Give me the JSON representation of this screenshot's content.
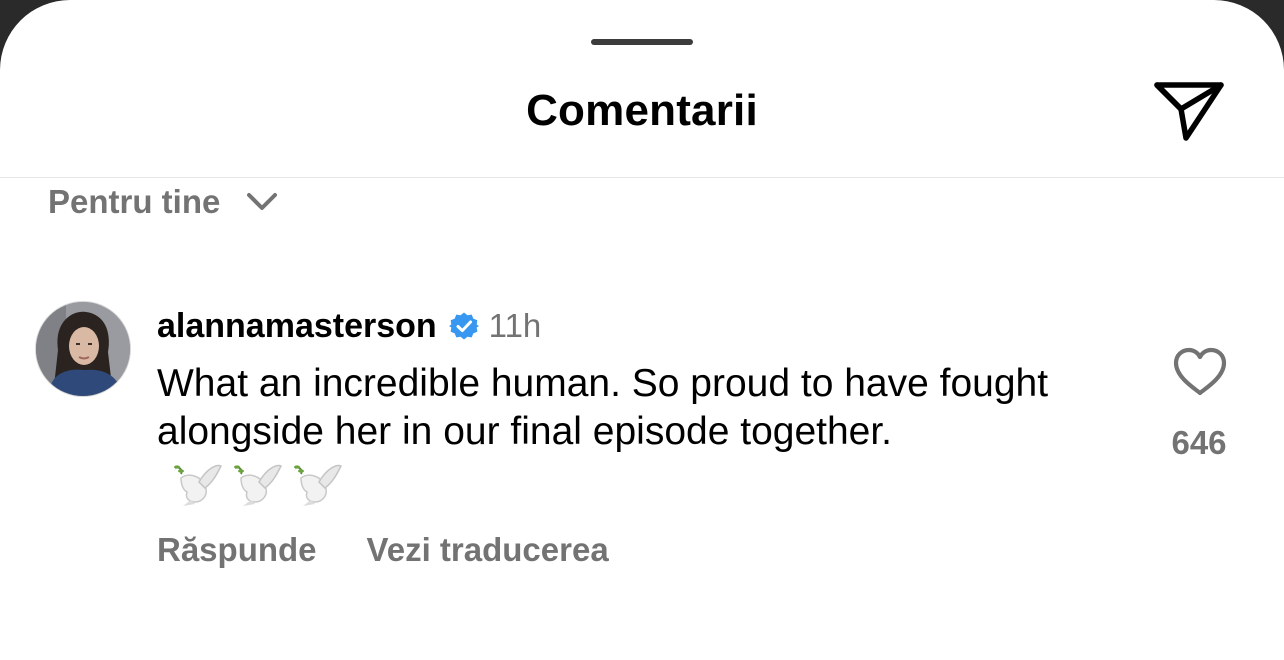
{
  "sheet": {
    "title": "Comentarii",
    "share_icon": "paper-plane-icon"
  },
  "sort": {
    "label": "Pentru tine",
    "icon": "chevron-down-icon"
  },
  "comment": {
    "username": "alannamasterson",
    "verified": true,
    "verified_color": "#3897f0",
    "timestamp": "11h",
    "text": "What an incredible human. So proud to have fought alongside her in our final episode together.",
    "emoji": "🕊️🕊️🕊️",
    "emoji_icons": [
      "dove-icon",
      "dove-icon",
      "dove-icon"
    ],
    "reply_label": "Răspunde",
    "translate_label": "Vezi traducerea",
    "like_icon": "heart-outline-icon",
    "like_count": "646"
  },
  "colors": {
    "text_primary": "#000000",
    "text_secondary": "#737373",
    "sheet_background": "#ffffff",
    "backdrop": "#2a2a2a"
  }
}
